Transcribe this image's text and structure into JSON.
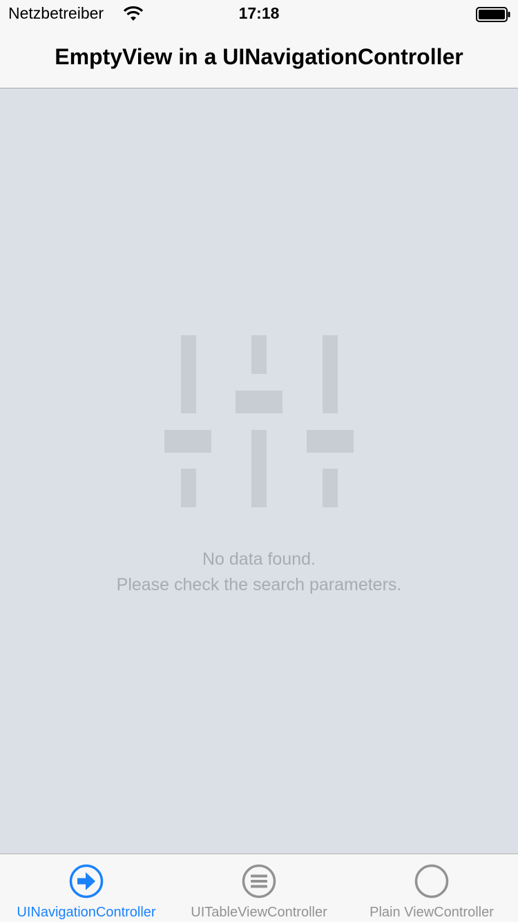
{
  "status_bar": {
    "carrier": "Netzbetreiber",
    "time": "17:18"
  },
  "nav": {
    "title": "EmptyView in a UINavigationController"
  },
  "empty_state": {
    "line1": "No data found.",
    "line2": "Please check the search parameters."
  },
  "tab_bar": {
    "tabs": [
      {
        "label": "UINavigationController",
        "icon": "arrow-right-circle-icon",
        "selected": true
      },
      {
        "label": "UITableViewController",
        "icon": "list-circle-icon",
        "selected": false
      },
      {
        "label": "Plain ViewController",
        "icon": "circle-icon",
        "selected": false
      }
    ]
  },
  "colors": {
    "background": "#dbdfe6",
    "accent": "#1a82fb",
    "inactive": "#929292",
    "empty_text": "#a7abb3"
  }
}
